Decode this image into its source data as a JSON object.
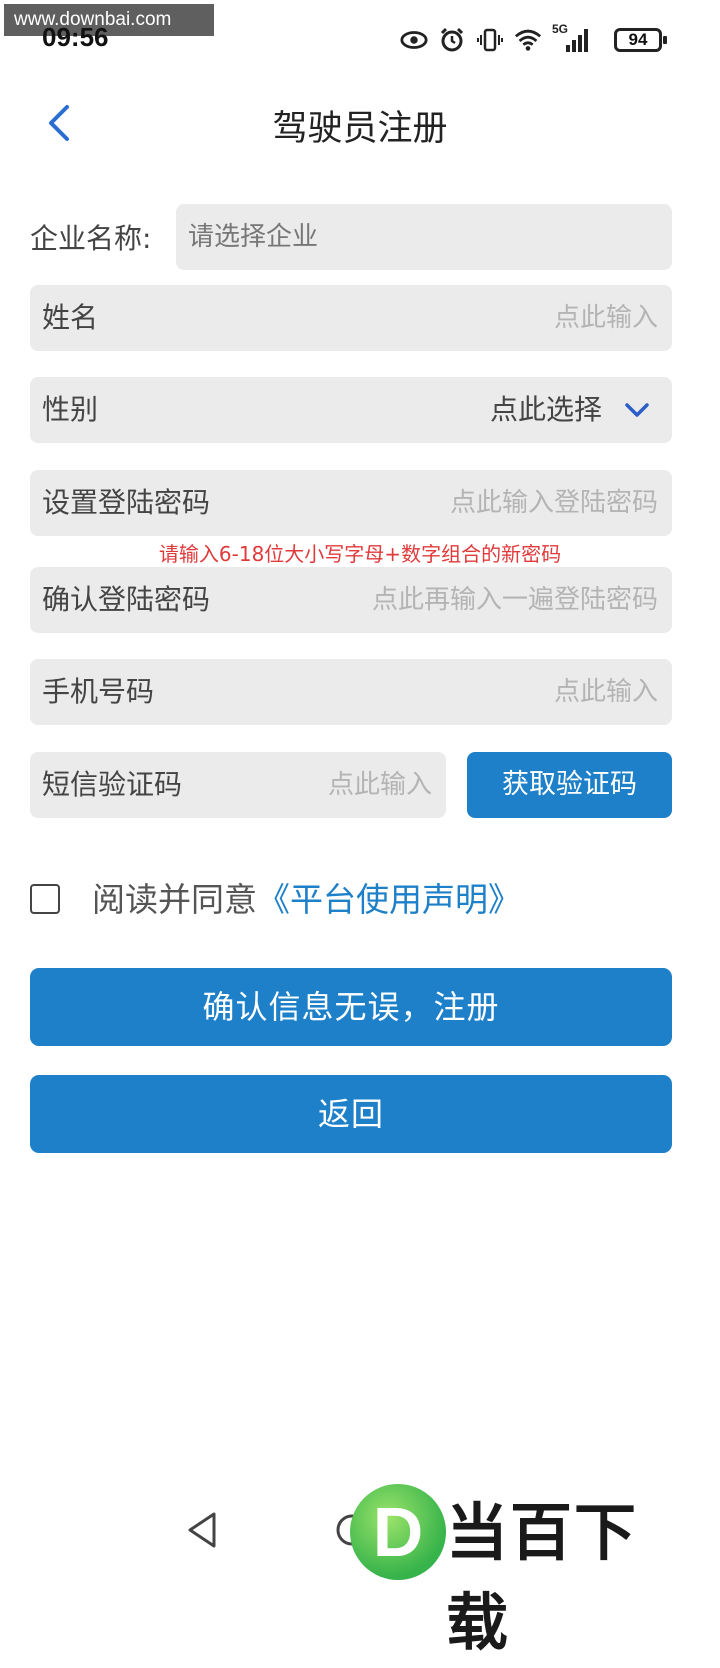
{
  "watermark": {
    "url": "www.downbai.com",
    "logo_letter": "D",
    "logo_text": "当百下载"
  },
  "status_bar": {
    "time": "09:56",
    "network": "5G",
    "battery": "94",
    "icons": [
      "eye-icon",
      "alarm-icon",
      "vibrate-icon",
      "wifi-icon",
      "signal-icon",
      "battery-icon"
    ]
  },
  "header": {
    "title": "驾驶员注册",
    "back_icon": "chevron-left-icon"
  },
  "form": {
    "company": {
      "label": "企业名称:",
      "placeholder": "请选择企业"
    },
    "name": {
      "label": "姓名",
      "placeholder": "点此输入"
    },
    "gender": {
      "label": "性别",
      "value": "点此选择"
    },
    "password": {
      "label": "设置登陆密码",
      "placeholder": "点此输入登陆密码"
    },
    "password_hint": "请输入6-18位大小写字母+数字组合的新密码",
    "confirm_password": {
      "label": "确认登陆密码",
      "placeholder": "点此再输入一遍登陆密码"
    },
    "phone": {
      "label": "手机号码",
      "placeholder": "点此输入"
    },
    "sms_code": {
      "label": "短信验证码",
      "placeholder": "点此输入",
      "button": "获取验证码"
    },
    "agreement": {
      "text": "阅读并同意",
      "link": "《平台使用声明》"
    }
  },
  "buttons": {
    "register": "确认信息无误，注册",
    "back": "返回"
  },
  "colors": {
    "primary": "#1e80c8",
    "hint": "#e03a3a",
    "field_bg": "#ebebeb"
  }
}
